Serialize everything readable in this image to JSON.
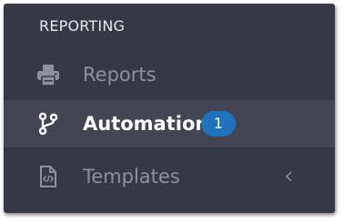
{
  "sidebar": {
    "section_title": "REPORTING",
    "items": [
      {
        "label": "Reports",
        "icon": "printer-icon"
      },
      {
        "label": "Automation",
        "icon": "git-branch-icon",
        "badge": "1",
        "active": true
      },
      {
        "label": "Templates",
        "icon": "code-file-icon",
        "has_submenu": true
      }
    ]
  },
  "colors": {
    "panel_background": "#363847",
    "active_row": "#434554",
    "badge": "#1f73bd",
    "muted_text": "#8d909e"
  }
}
